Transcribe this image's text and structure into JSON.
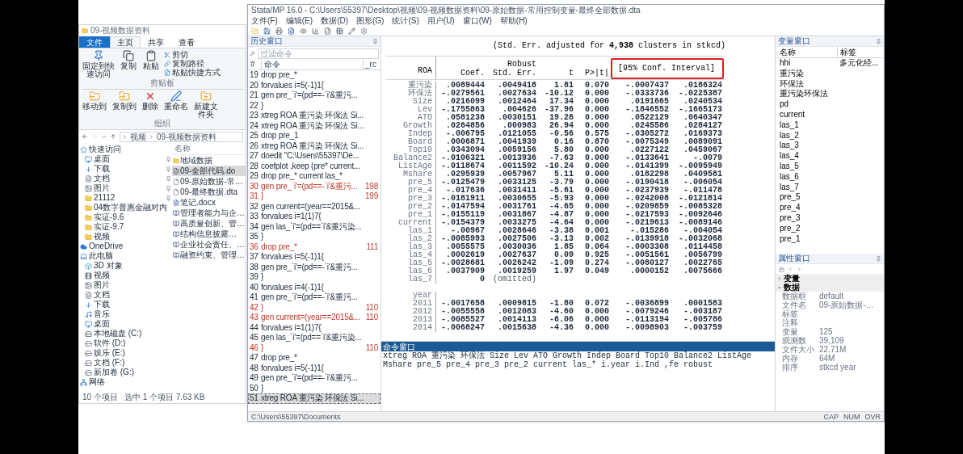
{
  "explorer": {
    "title": "09-视频数据资料",
    "ribbon_tabs": [
      {
        "label": "文件",
        "kind": "file",
        "selected": false
      },
      {
        "label": "主页",
        "kind": "tab",
        "selected": true
      },
      {
        "label": "共享",
        "kind": "tab",
        "selected": false
      },
      {
        "label": "查看",
        "kind": "tab",
        "selected": false
      }
    ],
    "clipboard": {
      "pin": "固定到快速访问",
      "copy": "复制",
      "paste": "粘贴",
      "cut": "剪切",
      "copy_path": "复制路径",
      "paste_shortcut": "粘贴快捷方式",
      "group": "剪贴板"
    },
    "organize": {
      "move_to": "移动到",
      "copy_to": "复制到",
      "delete": "删除",
      "rename": "重命名",
      "new_folder": "新建文件夹",
      "group": "组织"
    },
    "address": [
      "视频",
      "09-视频数据资料"
    ],
    "column": "名称",
    "navigation": [
      {
        "label": "快速访问",
        "kind": "star",
        "children": [
          {
            "label": "桌面",
            "kind": "desktop",
            "pinned": true
          },
          {
            "label": "下载",
            "kind": "download",
            "pinned": true
          },
          {
            "label": "文档",
            "kind": "document",
            "pinned": true
          },
          {
            "label": "图片",
            "kind": "picture",
            "pinned": true
          },
          {
            "label": "21112",
            "kind": "folder",
            "pinned": true
          },
          {
            "label": "04数字普惠金融对内",
            "kind": "folder",
            "pinned": false
          },
          {
            "label": "实证-9.6",
            "kind": "folder",
            "pinned": false
          },
          {
            "label": "实证-9.7",
            "kind": "folder",
            "pinned": false
          },
          {
            "label": "视频",
            "kind": "folder",
            "pinned": false
          }
        ]
      },
      {
        "label": "OneDrive",
        "kind": "cloud"
      },
      {
        "label": "此电脑",
        "kind": "computer",
        "children": [
          {
            "label": "3D 对象",
            "kind": "cube"
          },
          {
            "label": "视频",
            "kind": "video"
          },
          {
            "label": "图片",
            "kind": "picture"
          },
          {
            "label": "文档",
            "kind": "document"
          },
          {
            "label": "下载",
            "kind": "download"
          },
          {
            "label": "音乐",
            "kind": "music"
          },
          {
            "label": "桌面",
            "kind": "desktop"
          },
          {
            "label": "本地磁盘 (C:)",
            "kind": "disk"
          },
          {
            "label": "软件 (D:)",
            "kind": "drive"
          },
          {
            "label": "娱乐 (E:)",
            "kind": "drive"
          },
          {
            "label": "文档 (F:)",
            "kind": "drive"
          },
          {
            "label": "新加卷 (G:)",
            "kind": "drive"
          }
        ]
      },
      {
        "label": "网络",
        "kind": "network"
      }
    ],
    "files": [
      {
        "name": "地域数据",
        "kind": "folder",
        "selected": false
      },
      {
        "name": "09-全部代码.do",
        "kind": "do",
        "selected": true
      },
      {
        "name": "09-原始数据-常…",
        "kind": "file",
        "selected": false
      },
      {
        "name": "09-最终数据.dta",
        "kind": "file",
        "selected": false
      },
      {
        "name": "笔记.docx",
        "kind": "docx",
        "selected": false
      },
      {
        "name": "管理者能力与企…",
        "kind": "caj",
        "selected": false
      },
      {
        "name": "高质量创新、管…",
        "kind": "caj",
        "selected": false
      },
      {
        "name": "结构信息披露…",
        "kind": "caj",
        "selected": false
      },
      {
        "name": "企业社会责任、…",
        "kind": "caj",
        "selected": false
      },
      {
        "name": "融资约束、管理…",
        "kind": "caj",
        "selected": false
      }
    ],
    "status": {
      "count": "10 个项目",
      "selection": "选中 1 个项目 7.63 KB"
    }
  },
  "stata": {
    "title": "Stata/MP 16.0 - C:\\Users\\55397\\Desktop\\视频\\09-视频数据资料\\09-原始数据-常用控制变量-最终全部数据.dta",
    "menu": [
      "文件(F)",
      "编辑(E)",
      "数据(D)",
      "图形(G)",
      "统计(S)",
      "用户(U)",
      "窗口(W)",
      "帮助(H)"
    ],
    "history": {
      "title": "历史窗口",
      "placeholder": "过滤命令",
      "columns": [
        "#",
        "命令",
        "_rc"
      ],
      "items": [
        {
          "num": "19",
          "command": "drop pre_*",
          "selected": false
        },
        {
          "num": "20",
          "command": "forvalues i=5(-1)1{",
          "selected": false
        },
        {
          "num": "21",
          "command": "gen pre_`i'=(pd==-`i'&重污...",
          "selected": false
        },
        {
          "num": "22",
          "command": "}",
          "selected": false
        },
        {
          "num": "23",
          "command": "xtreg  ROA 重污染 环保法  Si...",
          "selected": false
        },
        {
          "num": "24",
          "command": "xtreg  ROA 重污染 环保法  Si...",
          "selected": false
        },
        {
          "num": "25",
          "command": "drop pre_1",
          "selected": false
        },
        {
          "num": "26",
          "command": "xtreg  ROA 重污染 环保法  Si...",
          "selected": false
        },
        {
          "num": "27",
          "command": "doedit \"C:\\Users\\55397\\De...",
          "selected": false
        },
        {
          "num": "28",
          "command": "coefplot ,keep (pre* current...",
          "selected": false
        },
        {
          "num": "29",
          "command": "drop pre_* current las_*",
          "selected": false
        },
        {
          "num": "30",
          "command": "gen pre_`i'=(pd==-`i'&重污...",
          "rc": "198",
          "selected": false
        },
        {
          "num": "31",
          "command": "}",
          "rc": "199",
          "selected": false
        },
        {
          "num": "32",
          "command": "gen current=(year==2015&...",
          "selected": false
        },
        {
          "num": "33",
          "command": "forvalues i=1(1)7{",
          "selected": false
        },
        {
          "num": "34",
          "command": "gen las_`i'=(pd==`i'&重污染...",
          "selected": false
        },
        {
          "num": "35",
          "command": "}",
          "selected": false
        },
        {
          "num": "36",
          "command": "drop pre_*",
          "rc": "111",
          "selected": false
        },
        {
          "num": "37",
          "command": "forvalues i=5(-1)1{",
          "selected": false
        },
        {
          "num": "38",
          "command": "gen pre_`i'=(pd==-`i'&重污...",
          "selected": false
        },
        {
          "num": "39",
          "command": "}",
          "selected": false
        },
        {
          "num": "40",
          "command": "forvalues i=4(-1)1{",
          "selected": false
        },
        {
          "num": "41",
          "command": "gen pre_`i'=(pd==-`i'&重污...",
          "selected": false
        },
        {
          "num": "42",
          "command": "}",
          "rc": "110",
          "selected": false
        },
        {
          "num": "43",
          "command": "gen current=(year==2015&...",
          "rc": "110",
          "selected": false
        },
        {
          "num": "44",
          "command": "forvalues i=1(1)7{",
          "selected": false
        },
        {
          "num": "45",
          "command": "gen las_`i'=(pd==`i'&重污染...",
          "selected": false
        },
        {
          "num": "46",
          "command": "}",
          "rc": "110",
          "selected": false
        },
        {
          "num": "47",
          "command": "drop pre_*",
          "selected": false
        },
        {
          "num": "48",
          "command": "forvalues i=5(-1)1{",
          "selected": false
        },
        {
          "num": "49",
          "command": "gen pre_`i'=(pd==-`i'&重污...",
          "selected": false
        },
        {
          "num": "50",
          "command": "}",
          "selected": false
        },
        {
          "num": "51",
          "command": "xtreg  ROA 重污染 环保法  Si...",
          "selected": true
        }
      ]
    },
    "results": {
      "note": "(Std. Err. adjusted for **4,938** clusters in stkcd)",
      "depvar": "ROA",
      "columns": [
        {
          "label": "Coef.",
          "kind": "single",
          "highlighted": false
        },
        {
          "top": "Robust",
          "label": "Std. Err.",
          "kind": "single",
          "highlighted": false
        },
        {
          "label": "t",
          "kind": "single",
          "highlighted": false
        },
        {
          "label": "P>|t|",
          "kind": "single",
          "highlighted": false
        },
        {
          "label": "[95% Conf. Interval]",
          "kind": "pair",
          "highlighted": true
        }
      ],
      "rows": [
        {
          "kind": "coef",
          "label": "重污染",
          "values": [
            ".0089444",
            ".0049418",
            "1.81",
            "0.070",
            "-.0007437",
            ".0186324"
          ]
        },
        {
          "kind": "coef",
          "label": "环保法",
          "values": [
            "-.0279561",
            ".0027634",
            "-10.12",
            "0.000",
            "-.0333736",
            "-.0225387"
          ]
        },
        {
          "kind": "coef",
          "label": "Size",
          "values": [
            ".0216099",
            ".0012464",
            "17.34",
            "0.000",
            ".0191665",
            ".0240534"
          ]
        },
        {
          "kind": "coef",
          "label": "Lev",
          "values": [
            "-.1755863",
            ".004626",
            "-37.96",
            "0.000",
            "-.1846552",
            "-.1665173"
          ]
        },
        {
          "kind": "coef",
          "label": "ATO",
          "values": [
            ".0581238",
            ".0030151",
            "19.28",
            "0.000",
            ".0522129",
            ".0640347"
          ]
        },
        {
          "kind": "coef",
          "label": "Growth",
          "values": [
            ".0264856",
            ".000983",
            "26.94",
            "0.000",
            ".0245586",
            ".0284127"
          ]
        },
        {
          "kind": "coef",
          "label": "Indep",
          "values": [
            "-.006795",
            ".0121055",
            "-0.56",
            "0.575",
            "-.0305272",
            ".0169373"
          ]
        },
        {
          "kind": "coef",
          "label": "Board",
          "values": [
            ".0006871",
            ".0041939",
            "0.16",
            "0.870",
            "-.0075349",
            ".0089091"
          ]
        },
        {
          "kind": "coef",
          "label": "Top10",
          "values": [
            ".0343094",
            ".0059156",
            "5.80",
            "0.000",
            ".0227122",
            ".0459067"
          ]
        },
        {
          "kind": "coef",
          "label": "Balance2",
          "values": [
            "-.0106321",
            ".0013936",
            "-7.63",
            "0.000",
            "-.0133641",
            "-.0079"
          ]
        },
        {
          "kind": "coef",
          "label": "ListAge",
          "values": [
            "-.0118674",
            ".0011592",
            "-10.24",
            "0.000",
            "-.0141399",
            "-.0095949"
          ]
        },
        {
          "kind": "coef",
          "label": "Mshare",
          "values": [
            ".0295939",
            ".0057967",
            "5.11",
            "0.000",
            ".0182298",
            ".0409581"
          ]
        },
        {
          "kind": "coef",
          "label": "pre_5",
          "values": [
            "-.0125479",
            ".0033125",
            "-3.79",
            "0.000",
            "-.0190418",
            "-.006054"
          ]
        },
        {
          "kind": "coef",
          "label": "pre_4",
          "values": [
            "-.017636",
            ".0031411",
            "-5.61",
            "0.000",
            "-.0237939",
            "-.011478"
          ]
        },
        {
          "kind": "coef",
          "label": "pre_3",
          "values": [
            "-.0181911",
            ".0030655",
            "-5.93",
            "0.000",
            "-.0242008",
            "-.0121814"
          ]
        },
        {
          "kind": "coef",
          "label": "pre_2",
          "values": [
            "-.0147594",
            ".0031761",
            "-4.65",
            "0.000",
            "-.0209859",
            "-.0085328"
          ]
        },
        {
          "kind": "coef",
          "label": "pre_1",
          "values": [
            "-.0155119",
            ".0031867",
            "-4.87",
            "0.000",
            "-.0217593",
            "-.0092646"
          ]
        },
        {
          "kind": "coef",
          "label": "current",
          "values": [
            "-.0154379",
            ".0033275",
            "-4.64",
            "0.000",
            "-.0219613",
            "-.0089146"
          ]
        },
        {
          "kind": "coef",
          "label": "las_1",
          "values": [
            "-.00967",
            ".0028646",
            "-3.38",
            "0.001",
            "-.015286",
            "-.004054"
          ]
        },
        {
          "kind": "coef",
          "label": "las_2",
          "values": [
            "-.0085993",
            ".0027506",
            "-3.13",
            "0.002",
            "-.0139918",
            "-.0032068"
          ]
        },
        {
          "kind": "coef",
          "label": "las_3",
          "values": [
            ".0055575",
            ".0030036",
            "1.85",
            "0.064",
            "-.0003308",
            ".0114458"
          ]
        },
        {
          "kind": "coef",
          "label": "las_4",
          "values": [
            ".0002619",
            ".0027637",
            "0.09",
            "0.925",
            "-.0051561",
            ".0056799"
          ]
        },
        {
          "kind": "coef",
          "label": "las_5",
          "values": [
            "-.0028681",
            ".0026242",
            "-1.09",
            "0.274",
            "-.0080127",
            ".0022765"
          ]
        },
        {
          "kind": "coef",
          "label": "las_6",
          "values": [
            ".0037909",
            ".0019259",
            "1.97",
            "0.049",
            ".0000152",
            ".0075666"
          ]
        },
        {
          "kind": "omitted",
          "label": "las_7",
          "values": [
            "0",
            "(omitted)"
          ]
        },
        {
          "kind": "group",
          "label": "year"
        },
        {
          "kind": "coef",
          "label": "2011",
          "values": [
            "-.0017658",
            ".0009815",
            "-1.80",
            "0.072",
            "-.0036899",
            ".0001583"
          ]
        },
        {
          "kind": "coef",
          "label": "2012",
          "values": [
            "-.0055558",
            ".0012083",
            "-4.60",
            "0.000",
            "-.0079246",
            "-.003187"
          ]
        },
        {
          "kind": "coef",
          "label": "2013",
          "values": [
            "-.0085527",
            ".0014113",
            "-6.06",
            "0.000",
            "-.0113194",
            "-.005786"
          ]
        },
        {
          "kind": "coef",
          "label": "2014",
          "values": [
            "-.0068247",
            ".0015638",
            "-4.36",
            "0.000",
            "-.0098903",
            "-.003759"
          ]
        }
      ]
    },
    "command_window": {
      "title": "命令窗口",
      "text": "xtreg  ROA 重污染 环保法  Size Lev ATO Growth Indep Board Top10 Balance2 ListAge Mshare pre_5 pre_4 pre_3 pre_2 current las_*  i.year i.Ind ,fe robust"
    },
    "variables": {
      "title": "变量窗口",
      "columns": [
        "名称",
        "标签"
      ],
      "items": [
        {
          "name": "hhi",
          "label": "多元化经..."
        },
        {
          "name": "重污染"
        },
        {
          "name": "环保法"
        },
        {
          "name": "重污染环保法"
        },
        {
          "name": "pd"
        },
        {
          "name": "current"
        },
        {
          "name": "las_1"
        },
        {
          "name": "las_2"
        },
        {
          "name": "las_3"
        },
        {
          "name": "las_4"
        },
        {
          "name": "las_5"
        },
        {
          "name": "las_6"
        },
        {
          "name": "las_7"
        },
        {
          "name": "pre_5"
        },
        {
          "name": "pre_4"
        },
        {
          "name": "pre_3"
        },
        {
          "name": "pre_2"
        },
        {
          "name": "pre_1"
        }
      ]
    },
    "properties": {
      "title": "属性窗口",
      "sections": [
        {
          "label": "变量",
          "expanded": false
        },
        {
          "label": "数据",
          "expanded": true,
          "items": [
            {
              "key": "数据框",
              "value": "default"
            },
            {
              "key": "文件名",
              "value": "09-原始数据-…"
            },
            {
              "key": "标签"
            },
            {
              "key": "注释"
            },
            {
              "key": "变量",
              "value": "125"
            },
            {
              "key": "观测数",
              "value": "39,109"
            },
            {
              "key": "文件大小",
              "value": "22.71M"
            },
            {
              "key": "内存",
              "value": "64M"
            },
            {
              "key": "排序",
              "value": "stkcd year"
            }
          ]
        }
      ]
    },
    "status_bar": {
      "path": "C:\\Users\\55397\\Documents",
      "indicators": [
        "CAP",
        "NUM",
        "OVR"
      ]
    }
  }
}
